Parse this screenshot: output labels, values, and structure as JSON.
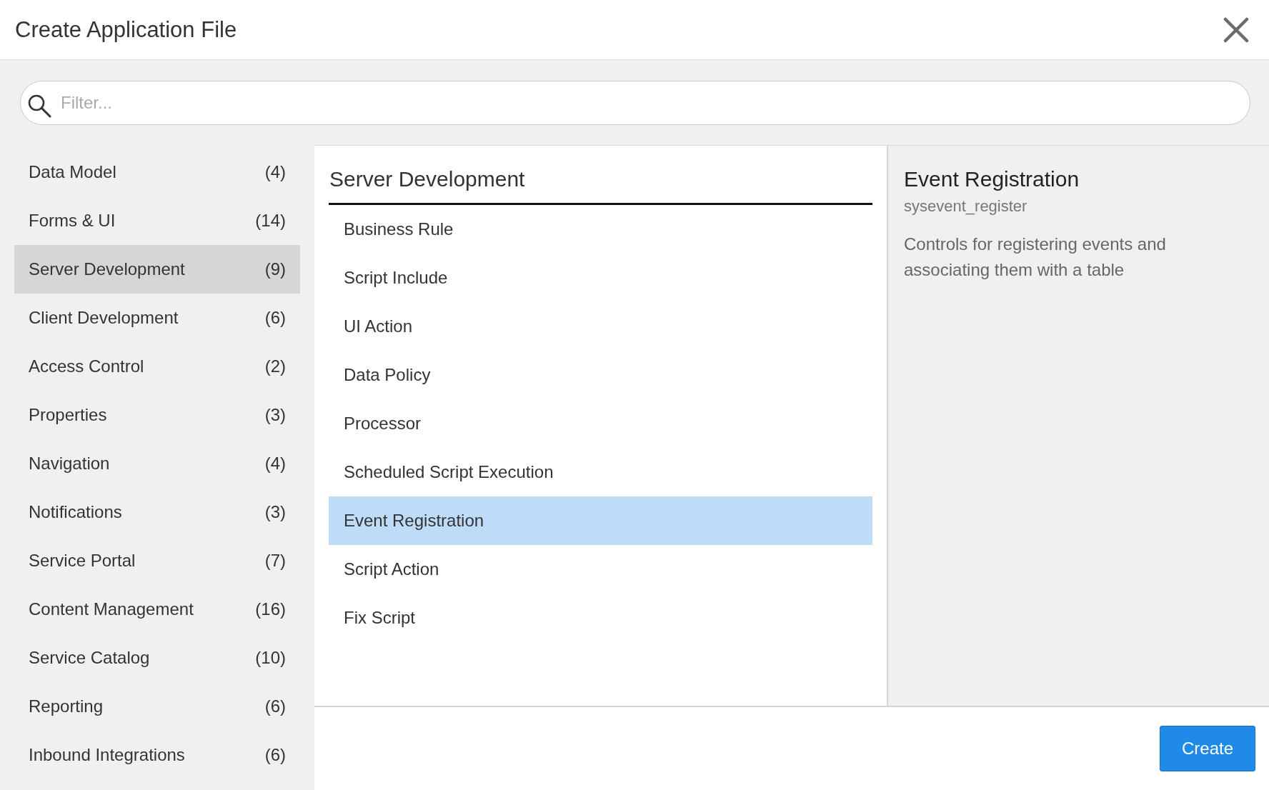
{
  "dialog": {
    "title": "Create Application File"
  },
  "search": {
    "placeholder": "Filter..."
  },
  "categories": [
    {
      "label": "Data Model",
      "count": "(4)",
      "selected": false
    },
    {
      "label": "Forms & UI",
      "count": "(14)",
      "selected": false
    },
    {
      "label": "Server Development",
      "count": "(9)",
      "selected": true
    },
    {
      "label": "Client Development",
      "count": "(6)",
      "selected": false
    },
    {
      "label": "Access Control",
      "count": "(2)",
      "selected": false
    },
    {
      "label": "Properties",
      "count": "(3)",
      "selected": false
    },
    {
      "label": "Navigation",
      "count": "(4)",
      "selected": false
    },
    {
      "label": "Notifications",
      "count": "(3)",
      "selected": false
    },
    {
      "label": "Service Portal",
      "count": "(7)",
      "selected": false
    },
    {
      "label": "Content Management",
      "count": "(16)",
      "selected": false
    },
    {
      "label": "Service Catalog",
      "count": "(10)",
      "selected": false
    },
    {
      "label": "Reporting",
      "count": "(6)",
      "selected": false
    },
    {
      "label": "Inbound Integrations",
      "count": "(6)",
      "selected": false
    }
  ],
  "file_types": {
    "title": "Server Development",
    "items": [
      {
        "label": "Business Rule",
        "selected": false
      },
      {
        "label": "Script Include",
        "selected": false
      },
      {
        "label": "UI Action",
        "selected": false
      },
      {
        "label": "Data Policy",
        "selected": false
      },
      {
        "label": "Processor",
        "selected": false
      },
      {
        "label": "Scheduled Script Execution",
        "selected": false
      },
      {
        "label": "Event Registration",
        "selected": true
      },
      {
        "label": "Script Action",
        "selected": false
      },
      {
        "label": "Fix Script",
        "selected": false
      }
    ]
  },
  "detail": {
    "title": "Event Registration",
    "table": "sysevent_register",
    "description": "Controls for registering events and associating them with a table"
  },
  "buttons": [
    {
      "label": "Create",
      "kind": "primary"
    }
  ]
}
